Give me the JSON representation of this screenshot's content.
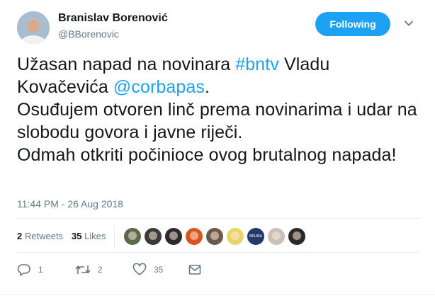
{
  "user": {
    "display_name": "Branislav Borenović",
    "handle": "@BBorenovic"
  },
  "follow_button": {
    "label": "Following"
  },
  "tweet": {
    "segments": [
      {
        "text": "Užasan napad na novinara ",
        "link": false
      },
      {
        "text": "#bntv",
        "link": true
      },
      {
        "text": " Vladu Kovačevića ",
        "link": false
      },
      {
        "text": "@corbapas",
        "link": true
      },
      {
        "text": ".",
        "link": false
      },
      {
        "text": "Osuđujem otvoren linč prema novinarima i udar na slobodu govora i javne riječi.",
        "link": false
      },
      {
        "text": "Odmah otkriti počinioce ovog brutalnog napada!",
        "link": false
      }
    ],
    "timestamp": "11:44 PM - 26 Aug 2018"
  },
  "stats": {
    "retweets_count": "2",
    "retweets_label": "Retweets",
    "likes_count": "35",
    "likes_label": "Likes"
  },
  "likers": [
    {
      "name": "liker-1",
      "color": "#5a6a4a"
    },
    {
      "name": "liker-2",
      "color": "#3a3a3a"
    },
    {
      "name": "liker-3",
      "color": "#2a2a30"
    },
    {
      "name": "liker-4",
      "color": "#d8561e"
    },
    {
      "name": "liker-5",
      "color": "#6a5a4a"
    },
    {
      "name": "liker-6",
      "color": "#e9d46a"
    },
    {
      "name": "liker-7",
      "color": "#223a6a",
      "text": "BELINA"
    },
    {
      "name": "liker-8",
      "color": "#c9c0b8"
    },
    {
      "name": "liker-9",
      "color": "#2a2a2a"
    }
  ],
  "actions": {
    "reply_count": "1",
    "retweet_count": "2",
    "like_count": "35"
  },
  "colors": {
    "accent": "#1da1f2",
    "muted": "#657786",
    "divider": "#e6ecf0"
  }
}
